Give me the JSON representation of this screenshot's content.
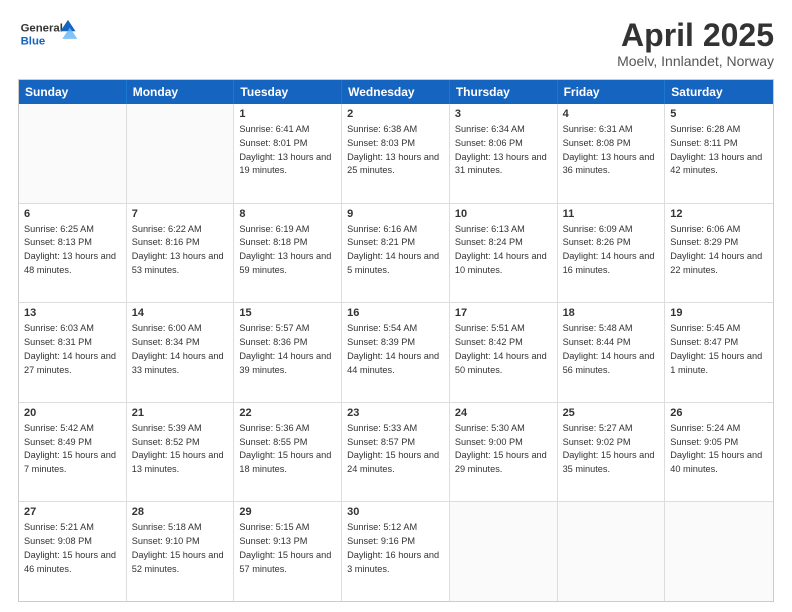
{
  "logo": {
    "general": "General",
    "blue": "Blue"
  },
  "title": "April 2025",
  "location": "Moelv, Innlandet, Norway",
  "days": [
    "Sunday",
    "Monday",
    "Tuesday",
    "Wednesday",
    "Thursday",
    "Friday",
    "Saturday"
  ],
  "weeks": [
    [
      {
        "day": "",
        "sunrise": "",
        "sunset": "",
        "daylight": ""
      },
      {
        "day": "",
        "sunrise": "",
        "sunset": "",
        "daylight": ""
      },
      {
        "day": "1",
        "sunrise": "Sunrise: 6:41 AM",
        "sunset": "Sunset: 8:01 PM",
        "daylight": "Daylight: 13 hours and 19 minutes."
      },
      {
        "day": "2",
        "sunrise": "Sunrise: 6:38 AM",
        "sunset": "Sunset: 8:03 PM",
        "daylight": "Daylight: 13 hours and 25 minutes."
      },
      {
        "day": "3",
        "sunrise": "Sunrise: 6:34 AM",
        "sunset": "Sunset: 8:06 PM",
        "daylight": "Daylight: 13 hours and 31 minutes."
      },
      {
        "day": "4",
        "sunrise": "Sunrise: 6:31 AM",
        "sunset": "Sunset: 8:08 PM",
        "daylight": "Daylight: 13 hours and 36 minutes."
      },
      {
        "day": "5",
        "sunrise": "Sunrise: 6:28 AM",
        "sunset": "Sunset: 8:11 PM",
        "daylight": "Daylight: 13 hours and 42 minutes."
      }
    ],
    [
      {
        "day": "6",
        "sunrise": "Sunrise: 6:25 AM",
        "sunset": "Sunset: 8:13 PM",
        "daylight": "Daylight: 13 hours and 48 minutes."
      },
      {
        "day": "7",
        "sunrise": "Sunrise: 6:22 AM",
        "sunset": "Sunset: 8:16 PM",
        "daylight": "Daylight: 13 hours and 53 minutes."
      },
      {
        "day": "8",
        "sunrise": "Sunrise: 6:19 AM",
        "sunset": "Sunset: 8:18 PM",
        "daylight": "Daylight: 13 hours and 59 minutes."
      },
      {
        "day": "9",
        "sunrise": "Sunrise: 6:16 AM",
        "sunset": "Sunset: 8:21 PM",
        "daylight": "Daylight: 14 hours and 5 minutes."
      },
      {
        "day": "10",
        "sunrise": "Sunrise: 6:13 AM",
        "sunset": "Sunset: 8:24 PM",
        "daylight": "Daylight: 14 hours and 10 minutes."
      },
      {
        "day": "11",
        "sunrise": "Sunrise: 6:09 AM",
        "sunset": "Sunset: 8:26 PM",
        "daylight": "Daylight: 14 hours and 16 minutes."
      },
      {
        "day": "12",
        "sunrise": "Sunrise: 6:06 AM",
        "sunset": "Sunset: 8:29 PM",
        "daylight": "Daylight: 14 hours and 22 minutes."
      }
    ],
    [
      {
        "day": "13",
        "sunrise": "Sunrise: 6:03 AM",
        "sunset": "Sunset: 8:31 PM",
        "daylight": "Daylight: 14 hours and 27 minutes."
      },
      {
        "day": "14",
        "sunrise": "Sunrise: 6:00 AM",
        "sunset": "Sunset: 8:34 PM",
        "daylight": "Daylight: 14 hours and 33 minutes."
      },
      {
        "day": "15",
        "sunrise": "Sunrise: 5:57 AM",
        "sunset": "Sunset: 8:36 PM",
        "daylight": "Daylight: 14 hours and 39 minutes."
      },
      {
        "day": "16",
        "sunrise": "Sunrise: 5:54 AM",
        "sunset": "Sunset: 8:39 PM",
        "daylight": "Daylight: 14 hours and 44 minutes."
      },
      {
        "day": "17",
        "sunrise": "Sunrise: 5:51 AM",
        "sunset": "Sunset: 8:42 PM",
        "daylight": "Daylight: 14 hours and 50 minutes."
      },
      {
        "day": "18",
        "sunrise": "Sunrise: 5:48 AM",
        "sunset": "Sunset: 8:44 PM",
        "daylight": "Daylight: 14 hours and 56 minutes."
      },
      {
        "day": "19",
        "sunrise": "Sunrise: 5:45 AM",
        "sunset": "Sunset: 8:47 PM",
        "daylight": "Daylight: 15 hours and 1 minute."
      }
    ],
    [
      {
        "day": "20",
        "sunrise": "Sunrise: 5:42 AM",
        "sunset": "Sunset: 8:49 PM",
        "daylight": "Daylight: 15 hours and 7 minutes."
      },
      {
        "day": "21",
        "sunrise": "Sunrise: 5:39 AM",
        "sunset": "Sunset: 8:52 PM",
        "daylight": "Daylight: 15 hours and 13 minutes."
      },
      {
        "day": "22",
        "sunrise": "Sunrise: 5:36 AM",
        "sunset": "Sunset: 8:55 PM",
        "daylight": "Daylight: 15 hours and 18 minutes."
      },
      {
        "day": "23",
        "sunrise": "Sunrise: 5:33 AM",
        "sunset": "Sunset: 8:57 PM",
        "daylight": "Daylight: 15 hours and 24 minutes."
      },
      {
        "day": "24",
        "sunrise": "Sunrise: 5:30 AM",
        "sunset": "Sunset: 9:00 PM",
        "daylight": "Daylight: 15 hours and 29 minutes."
      },
      {
        "day": "25",
        "sunrise": "Sunrise: 5:27 AM",
        "sunset": "Sunset: 9:02 PM",
        "daylight": "Daylight: 15 hours and 35 minutes."
      },
      {
        "day": "26",
        "sunrise": "Sunrise: 5:24 AM",
        "sunset": "Sunset: 9:05 PM",
        "daylight": "Daylight: 15 hours and 40 minutes."
      }
    ],
    [
      {
        "day": "27",
        "sunrise": "Sunrise: 5:21 AM",
        "sunset": "Sunset: 9:08 PM",
        "daylight": "Daylight: 15 hours and 46 minutes."
      },
      {
        "day": "28",
        "sunrise": "Sunrise: 5:18 AM",
        "sunset": "Sunset: 9:10 PM",
        "daylight": "Daylight: 15 hours and 52 minutes."
      },
      {
        "day": "29",
        "sunrise": "Sunrise: 5:15 AM",
        "sunset": "Sunset: 9:13 PM",
        "daylight": "Daylight: 15 hours and 57 minutes."
      },
      {
        "day": "30",
        "sunrise": "Sunrise: 5:12 AM",
        "sunset": "Sunset: 9:16 PM",
        "daylight": "Daylight: 16 hours and 3 minutes."
      },
      {
        "day": "",
        "sunrise": "",
        "sunset": "",
        "daylight": ""
      },
      {
        "day": "",
        "sunrise": "",
        "sunset": "",
        "daylight": ""
      },
      {
        "day": "",
        "sunrise": "",
        "sunset": "",
        "daylight": ""
      }
    ]
  ]
}
